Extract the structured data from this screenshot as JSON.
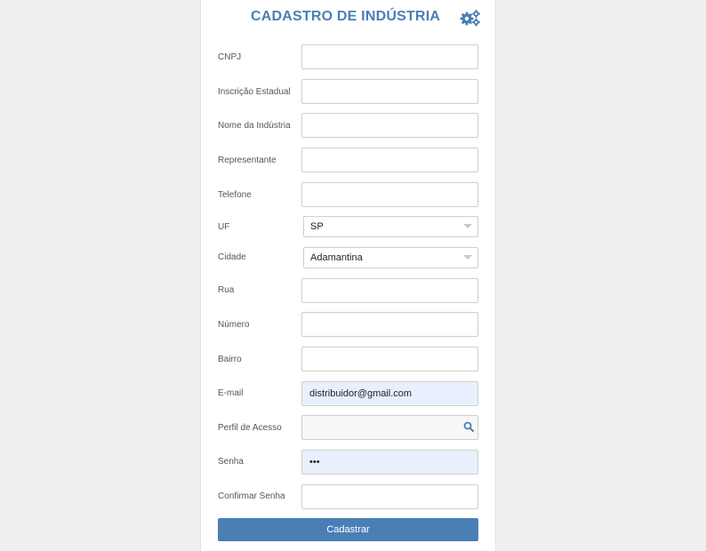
{
  "title": "CADASTRO DE INDÚSTRIA",
  "settings_icon": "gears-icon",
  "colors": {
    "accent": "#4a7fb5",
    "autofill": "#e8f0fe"
  },
  "fields": {
    "cnpj": {
      "label": "CNPJ",
      "value": ""
    },
    "inscricao": {
      "label": "Inscrição Estadual",
      "value": ""
    },
    "nome": {
      "label": "Nome da Indústria",
      "value": ""
    },
    "representante": {
      "label": "Representante",
      "value": ""
    },
    "telefone": {
      "label": "Telefone",
      "value": ""
    },
    "uf": {
      "label": "UF",
      "value": "SP"
    },
    "cidade": {
      "label": "Cidade",
      "value": "Adamantina"
    },
    "rua": {
      "label": "Rua",
      "value": ""
    },
    "numero": {
      "label": "Número",
      "value": ""
    },
    "bairro": {
      "label": "Bairro",
      "value": ""
    },
    "email": {
      "label": "E-mail",
      "value": "distribuidor@gmail.com"
    },
    "perfil": {
      "label": "Perfil de Acesso",
      "value": "",
      "icon": "search-icon"
    },
    "senha": {
      "label": "Senha",
      "value": "•••"
    },
    "confirmar": {
      "label": "Confirmar Senha",
      "value": ""
    }
  },
  "submit_label": "Cadastrar"
}
